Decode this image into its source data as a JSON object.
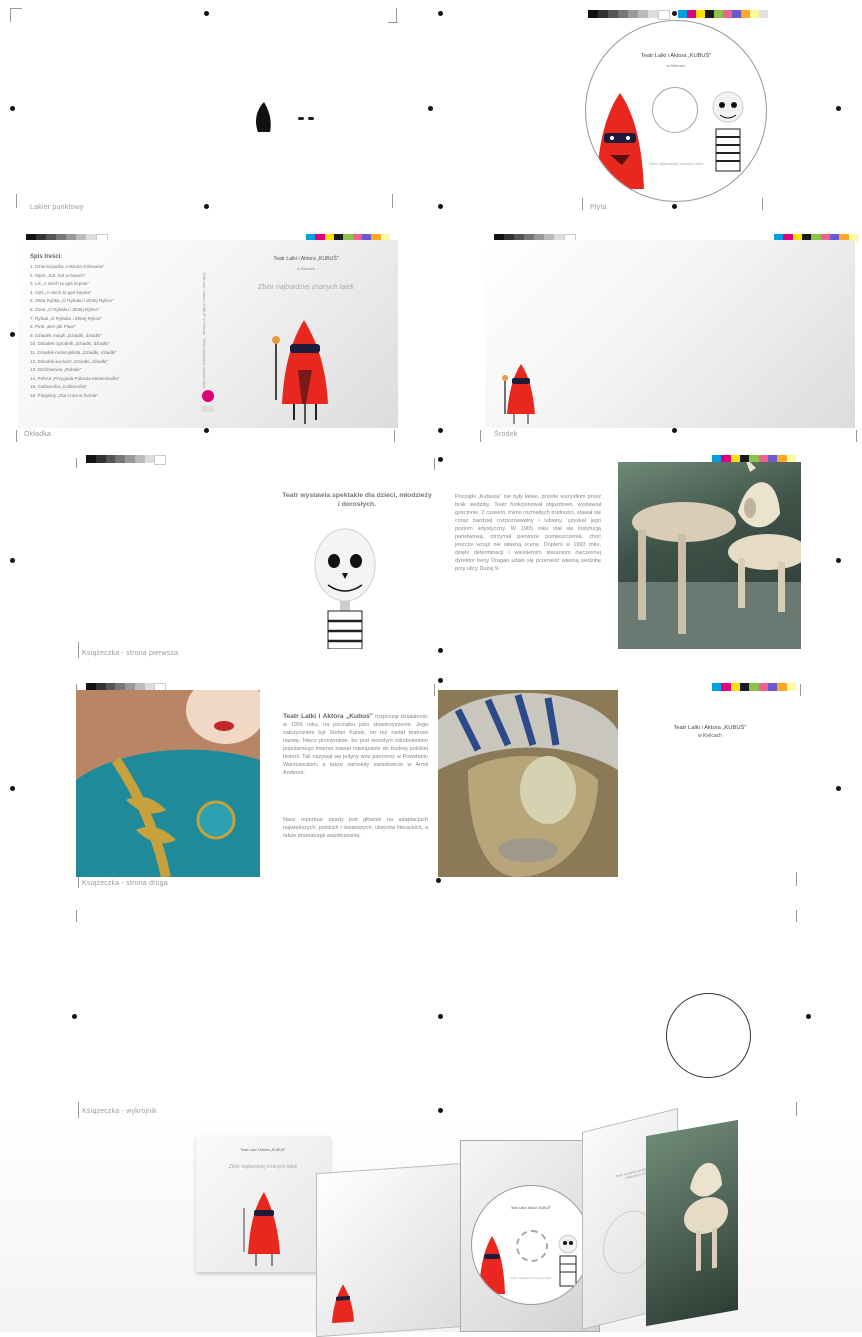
{
  "labels": {
    "sticker_label": "Lakier punktowy",
    "disc_label": "Płyta",
    "cover_label": "Okładka",
    "tray_label": "Środek",
    "booklet_first": "Książeczka - strona pierwsza",
    "booklet_second": "Książeczka - strona druga",
    "booklet_insert": "Książeczka - wykrojnik"
  },
  "disc": {
    "title": "Teatr Lalki i Aktora „KUBUŚ\"",
    "city": "w Kielcach",
    "subtitle": "Zbiór najbardziej znanych lalek"
  },
  "cover": {
    "toc_heading": "Spis treści:",
    "toc": [
      "1. Dzieciozjadka „Historia zmkwaria\"",
      "2. Mysz „Kot, kot w butach\"",
      "3. Lis „A niech to gęś kopnie\"",
      "4. Gęś „A niech to gęś kopnie\"",
      "5. Złota Rybka „O Rybaku i Złotej Rybce\"",
      "6. Żona „O Rybaku i Złotej Rybce\"",
      "7. Rybak „O Rybaku i Złotej Rybce\"",
      "8. Pirat „Bez jak Plaer\"",
      "9. Dziadek magik „Dziadki, dziadki\"",
      "10. Dziadek ogrodnik „Dziadki, dziadki\"",
      "11. Dziadek motocyklista „Dziadki, dziadki\"",
      "12. Dziadek kucharz „Dziadki, dziadki\"",
      "13. Dżdżownica „Robale\"",
      "14. Pobrut „Przygoda Pobruta Mniamniuśla\"",
      "15. Calineczka „Calineczka\"",
      "16. Pingwiny „Ola Anna w formie\""
    ],
    "front_title": "Teatr Lalki i Aktora „KUBUŚ\"",
    "front_city": "w Kielcach",
    "front_subtitle": "Zbiór najbardziej znanych lalek",
    "spine_text": "Teatr Lalki i Aktora „KUBUŚ\" w Kielcach · Zbiór najbardziej znanych lalek"
  },
  "booklet": {
    "headline": "Teatr wystawia spektakle dla dzieci, młodzieży i dorosłych.",
    "history_text": "Początki „Kubusia\" nie były łatwe, przede wszystkim przez brak siedziby. Teatr funkcjonował objazdowo, wystawiał gościnnie. Z czasem, mimo rozmaitych trudności, stawał się coraz bardziej rozpoznawalny i lubiany, uzyskał jego poziom artystyczny. W 1965 roku stał się instytucją państwową, otrzymał pierwsze pomieszczenia, choć jeszcze wciąż nie własną scenę. Dopiero w 1993 roku, dzięki determinacji i wieloletnim staraniom ówczesnej dyrektor Ireny Dragan udało się przenieść własną siedzibę przy ulicy Dużej 9.",
    "about_lead": "Teatr Lalki i Aktora „Kubuś\"",
    "about_text": " rozpoczął działalność w 1955 roku, na początku jako stowarzyszenie. Jego założycielem był Stefan Karski, on też nadał teatrowi nazwę. Nieco przewrotnie, bo pod wesołym zdrobnieniem popularnego imienia zawarł nawiązanie do trudnej polskiej historii. Tak nazywał się jedyny wóz pancerny w Powstaniu Warszawskim, a także samoloty zwiadowcze w Armii Andersa.",
    "repertoire_text": "Nasz repertuar oparty jest głównie na adaptacjach największych, polskich i światowych, utworów literackich, a także dramaturgii współczesnej.",
    "back_title": "Teatr Lalki i Aktora „KUBUŚ\"",
    "back_city": "w Kielcach"
  },
  "mockup": {
    "cover_title": "Teatr Lalki i Aktora „KUBUŚ\"",
    "cover_subtitle": "Zbiór najbardziej znanych lalek",
    "disc_title": "Teatr Lalki i Aktora „KUBUŚ\"",
    "disc_subtitle": "Zbiór najbardziej znanych lalek",
    "booklet_headline": "Teatr wystawia spektakle dla dzieci, młodzieży i dorosłych."
  },
  "colors": {
    "puppet_red": "#e8281e",
    "mask_dark": "#1c1c3a",
    "background": "#ffffff",
    "teal_costume": "#1f8a9a",
    "gold_trim": "#c7a23c"
  }
}
